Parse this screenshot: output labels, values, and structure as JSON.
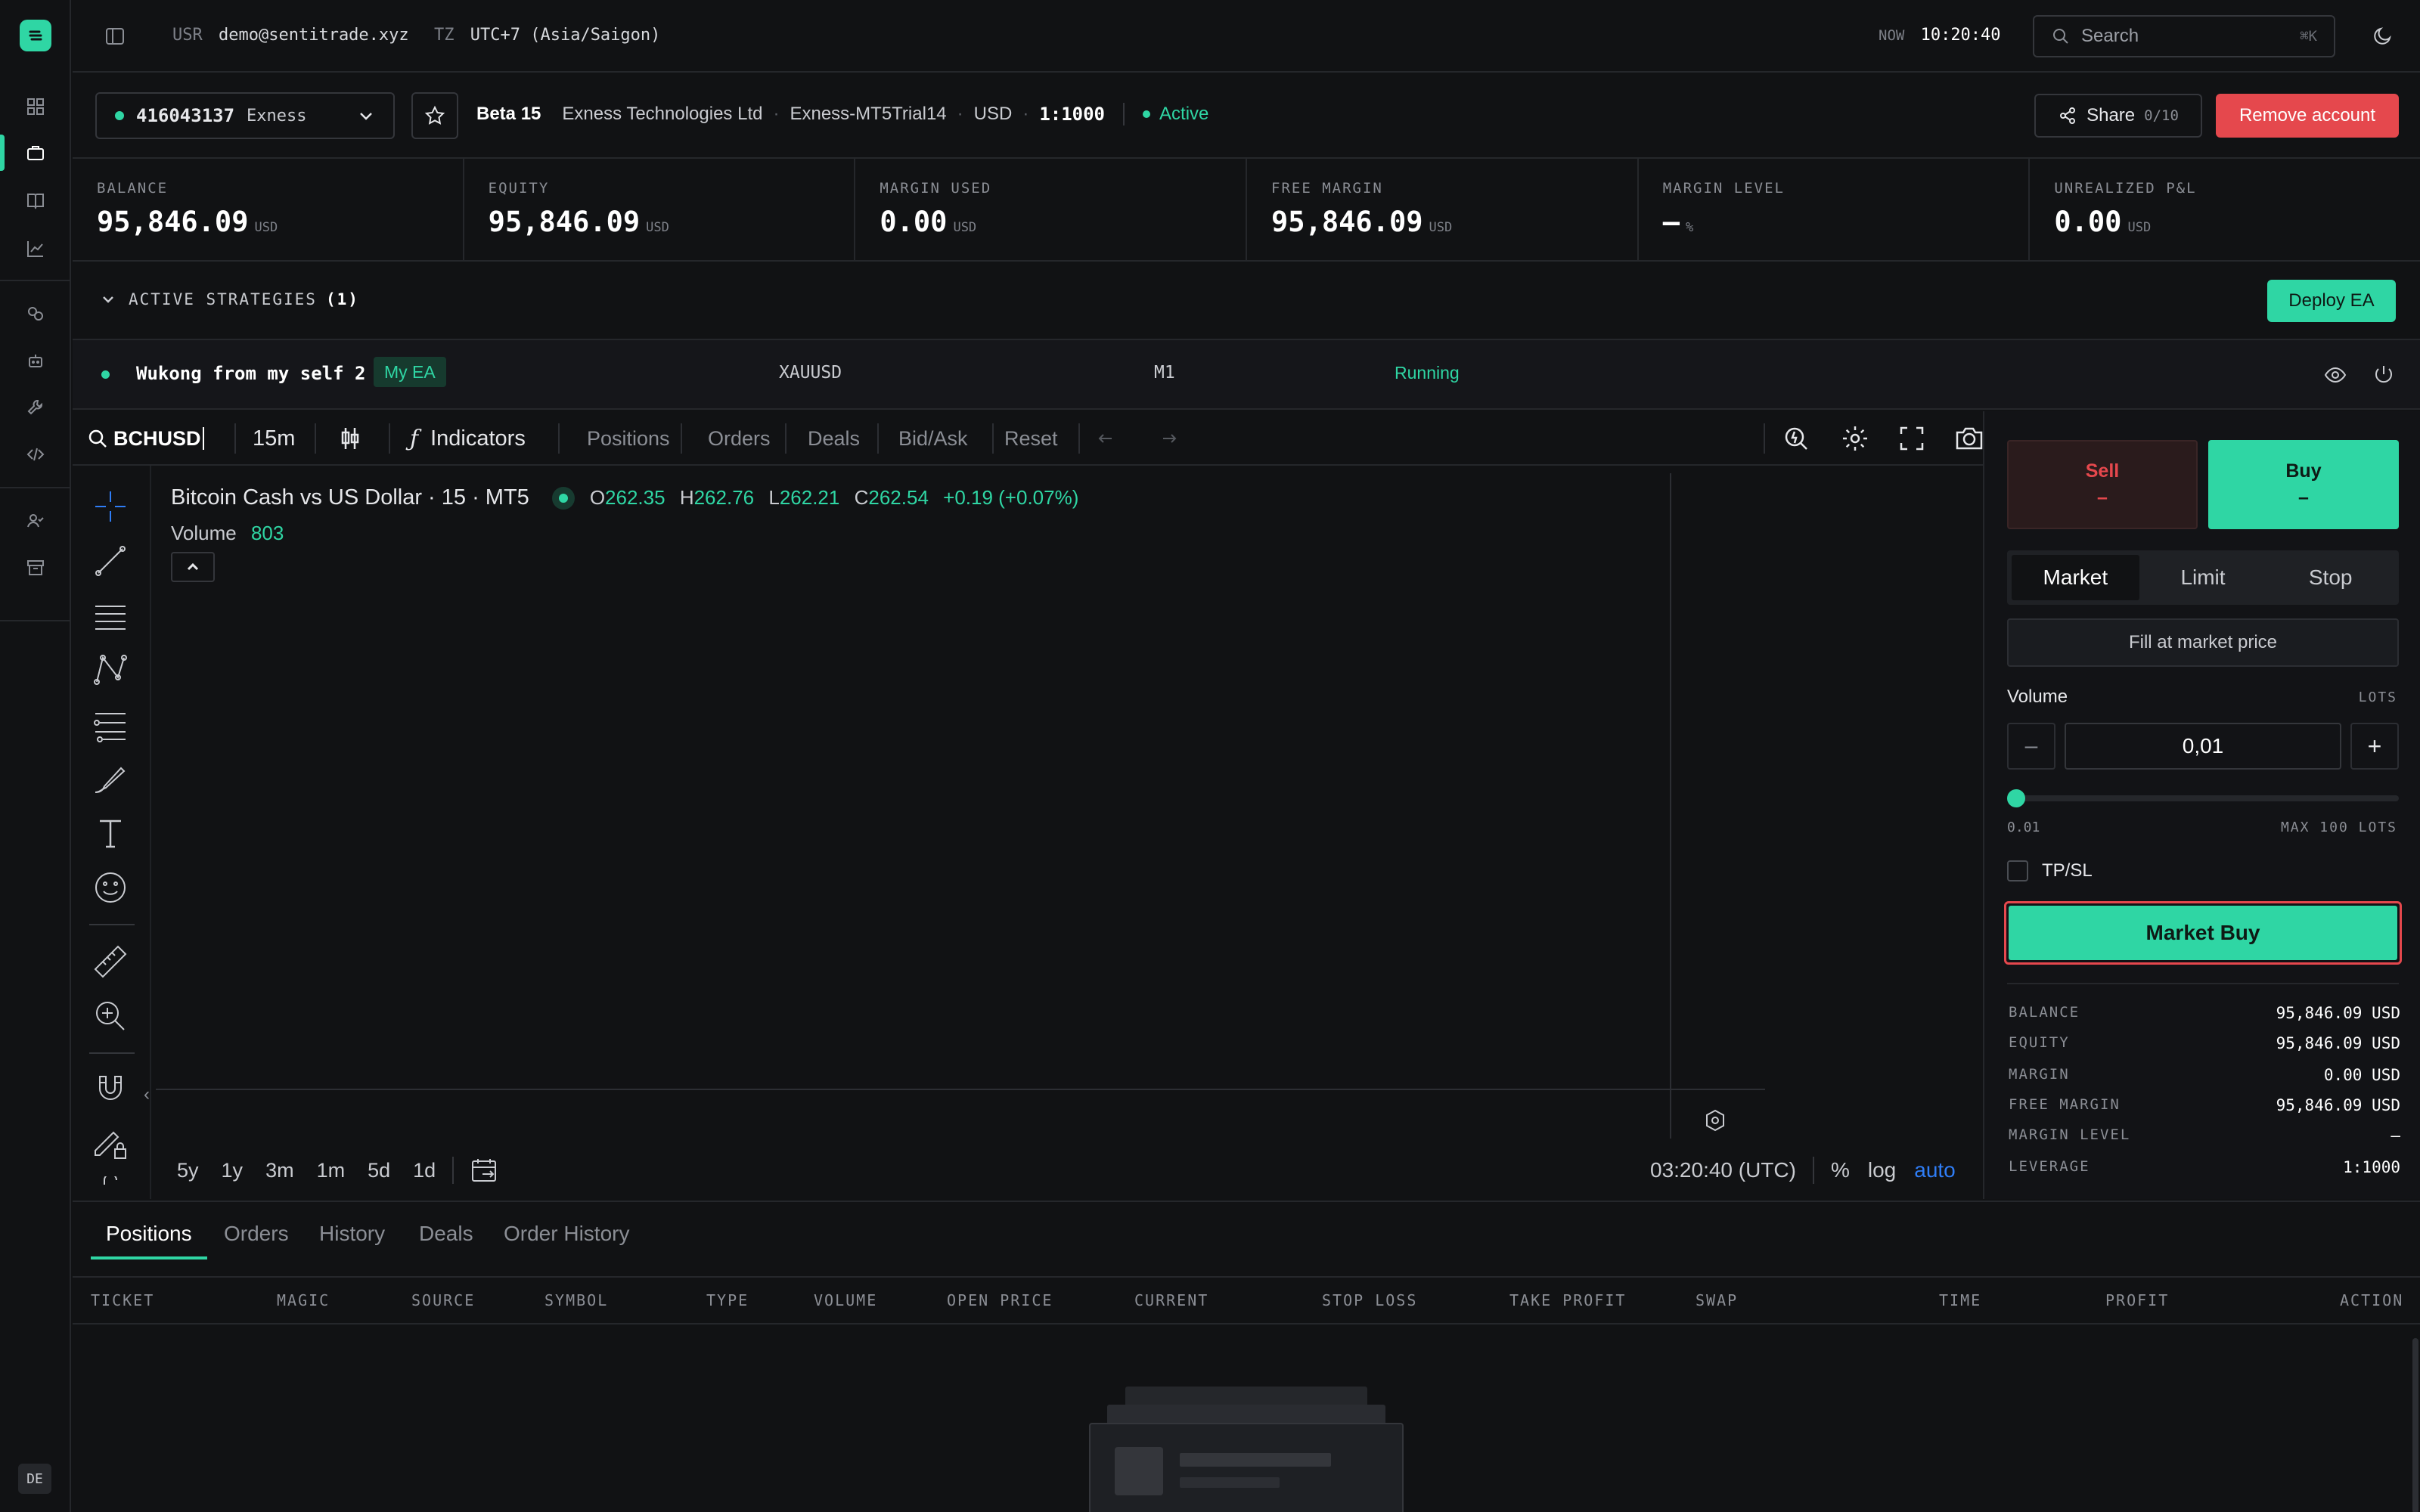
{
  "topbar": {
    "usr_label": "USR",
    "user_email": "demo@sentitrade.xyz",
    "tz_label": "TZ",
    "timezone": "UTC+7 (Asia/Saigon)",
    "now_label": "NOW",
    "now_time": "10:20:40",
    "search_placeholder": "Search",
    "search_shortcut": "⌘K"
  },
  "account": {
    "id": "416043137",
    "broker": "Exness",
    "tier": "Beta 15",
    "company": "Exness Technologies Ltd",
    "server": "Exness-MT5Trial14",
    "currency": "USD",
    "leverage": "1:1000",
    "status": "Active",
    "share_label": "Share",
    "share_count": "0/10",
    "remove_label": "Remove account"
  },
  "stats": [
    {
      "label": "BALANCE",
      "value": "95,846.09",
      "unit": "USD"
    },
    {
      "label": "EQUITY",
      "value": "95,846.09",
      "unit": "USD"
    },
    {
      "label": "MARGIN USED",
      "value": "0.00",
      "unit": "USD"
    },
    {
      "label": "FREE MARGIN",
      "value": "95,846.09",
      "unit": "USD"
    },
    {
      "label": "MARGIN LEVEL",
      "value": "—",
      "unit": "%"
    },
    {
      "label": "UNREALIZED P&L",
      "value": "0.00",
      "unit": "USD"
    }
  ],
  "strategies": {
    "header": "ACTIVE STRATEGIES",
    "count": "(1)",
    "deploy_label": "Deploy EA",
    "row": {
      "name": "Wukong from my self 2",
      "tag": "My EA",
      "symbol": "XAUUSD",
      "timeframe": "M1",
      "status": "Running"
    }
  },
  "chart": {
    "symbol_input": "BCHUSD",
    "interval": "15m",
    "indicators_label": "Indicators",
    "toolbar_items": [
      "Positions",
      "Orders",
      "Deals",
      "Bid/Ask",
      "Reset"
    ],
    "title": "Bitcoin Cash vs US Dollar · 15 · MT5",
    "ohlc": {
      "o_label": "O",
      "o": "262.35",
      "h_label": "H",
      "h": "262.76",
      "l_label": "L",
      "l": "262.21",
      "c_label": "C",
      "c": "262.54",
      "change": "+0.19 (+0.07%)"
    },
    "volume_label": "Volume",
    "volume_value": "803",
    "ranges": [
      "5y",
      "1y",
      "3m",
      "1m",
      "5d",
      "1d"
    ],
    "clock": "03:20:40 (UTC)",
    "scale_pct": "%",
    "scale_log": "log",
    "scale_auto": "auto"
  },
  "order_panel": {
    "sell_label": "Sell",
    "sell_price": "–",
    "buy_label": "Buy",
    "buy_price": "–",
    "order_types": [
      "Market",
      "Limit",
      "Stop"
    ],
    "fill_label": "Fill at market price",
    "volume_label": "Volume",
    "volume_unit": "LOTS",
    "volume_value": "0,01",
    "volume_fraction": 0.0,
    "min_label": "0.01",
    "max_label": "MAX 100 LOTS",
    "tpsl_label": "TP/SL",
    "submit_label": "Market Buy",
    "summary": [
      {
        "k": "BALANCE",
        "v": "95,846.09 USD"
      },
      {
        "k": "EQUITY",
        "v": "95,846.09 USD"
      },
      {
        "k": "MARGIN",
        "v": "0.00 USD"
      },
      {
        "k": "FREE MARGIN",
        "v": "95,846.09 USD"
      },
      {
        "k": "MARGIN LEVEL",
        "v": "—"
      },
      {
        "k": "LEVERAGE",
        "v": "1:1000"
      }
    ]
  },
  "bottom": {
    "tabs": [
      "Positions",
      "Orders",
      "History",
      "Deals",
      "Order History"
    ],
    "columns": [
      "TICKET",
      "MAGIC",
      "SOURCE",
      "SYMBOL",
      "TYPE",
      "VOLUME",
      "OPEN PRICE",
      "CURRENT",
      "STOP LOSS",
      "TAKE PROFIT",
      "SWAP",
      "TIME",
      "PROFIT",
      "ACTION"
    ]
  },
  "rail": {
    "lang": "DE"
  },
  "colors": {
    "accent": "#2fd6a4",
    "danger": "#e5484d",
    "focus_ring": "#e5484d",
    "bg": "#111214"
  }
}
